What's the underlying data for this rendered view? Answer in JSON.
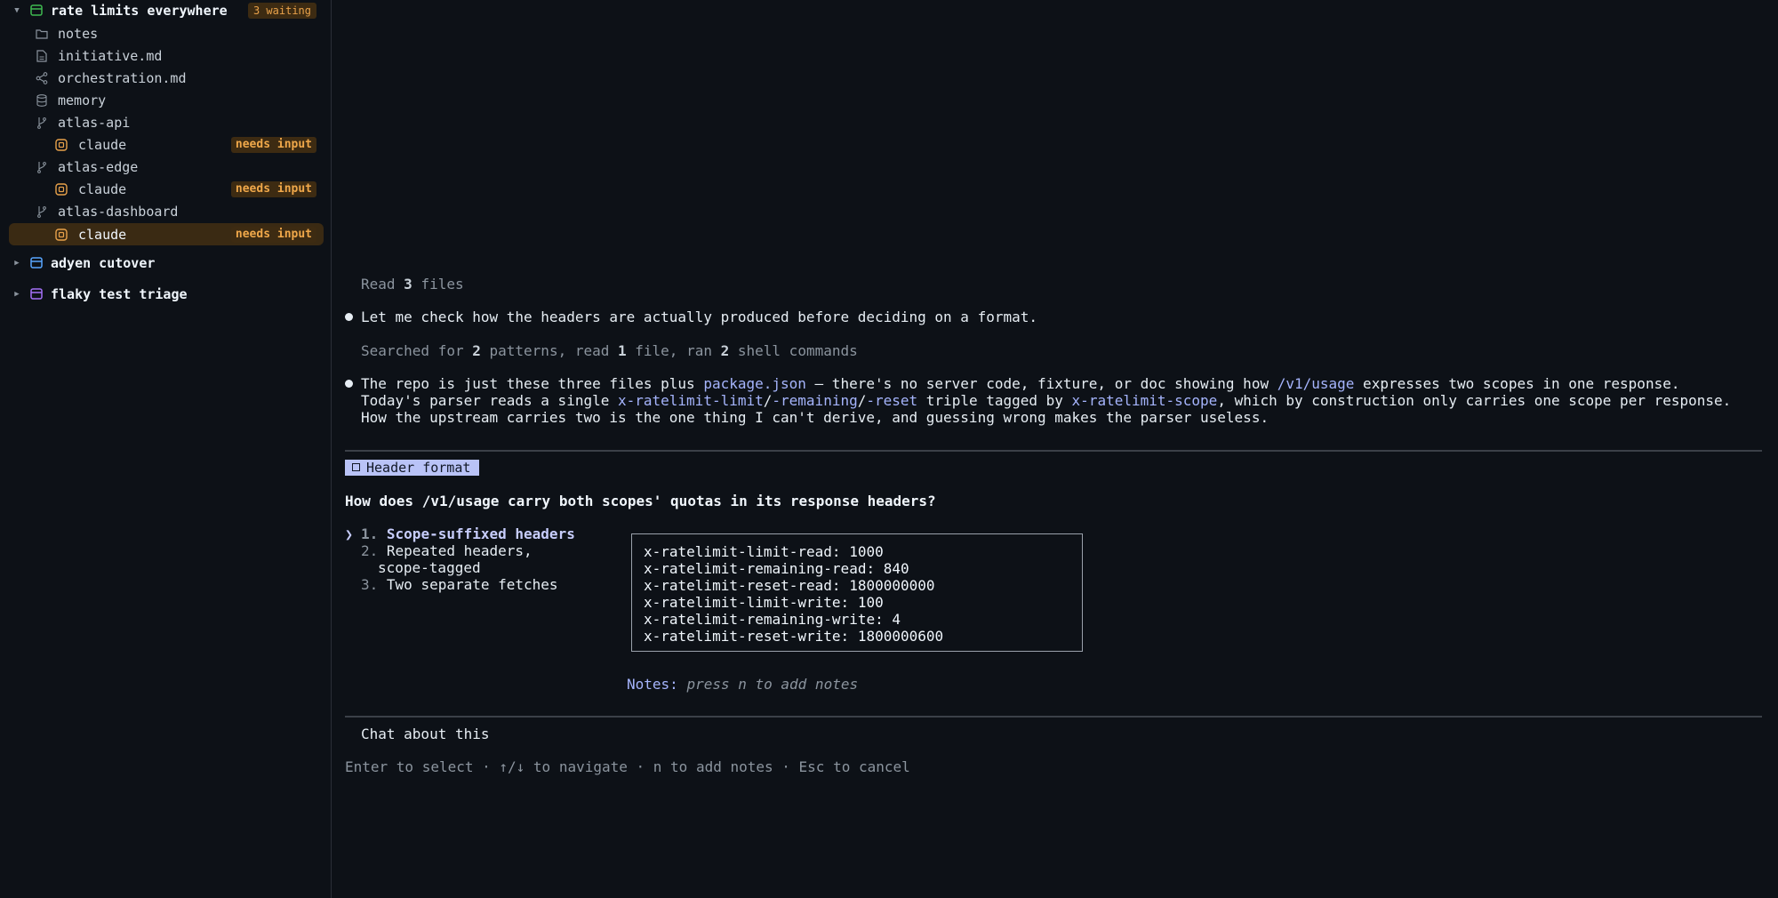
{
  "sidebar": {
    "projects": [
      {
        "name": "rate limits everywhere",
        "status": "3 waiting",
        "icon": "folder-stack-icon",
        "color": "#3fb950"
      },
      {
        "name": "adyen cutover",
        "icon": "folder-stack-icon",
        "color": "#58a6ff"
      },
      {
        "name": "flaky test triage",
        "icon": "folder-stack-icon",
        "color": "#a371f7"
      }
    ],
    "items": [
      {
        "label": "notes",
        "icon": "folder-icon"
      },
      {
        "label": "initiative.md",
        "icon": "file-icon"
      },
      {
        "label": "orchestration.md",
        "icon": "share-icon"
      },
      {
        "label": "memory",
        "icon": "database-icon"
      },
      {
        "label": "atlas-api",
        "icon": "branch-icon"
      },
      {
        "label": "claude",
        "icon": "agent-icon",
        "badge": "needs input"
      },
      {
        "label": "atlas-edge",
        "icon": "branch-icon"
      },
      {
        "label": "claude",
        "icon": "agent-icon",
        "badge": "needs input"
      },
      {
        "label": "atlas-dashboard",
        "icon": "branch-icon"
      },
      {
        "label": "claude",
        "icon": "agent-icon",
        "badge": "needs input"
      }
    ]
  },
  "chat": {
    "read_files": {
      "pre": "Read ",
      "count": "3",
      "post": " files"
    },
    "msg1": "Let me check how the headers are actually produced before deciding on a format.",
    "searched": {
      "p1": "Searched for ",
      "n1": "2",
      "p2": " patterns, read ",
      "n2": "1",
      "p3": " file, ran ",
      "n3": "2",
      "p4": " shell commands"
    },
    "msg2": {
      "t1": "The repo is just these three files plus ",
      "c1": "package.json",
      "t2": " — there's no server code, fixture, or doc showing how ",
      "c2": "/v1/usage",
      "t3": " expresses two scopes in one response. Today's parser reads a single ",
      "c3": "x-ratelimit-limit",
      "t4": "/",
      "c4": "-remaining",
      "t5": "/",
      "c5": "-reset",
      "t6": " triple tagged by ",
      "c6": "x-ratelimit-scope",
      "t7": ", which by construction only carries one scope per response. How the upstream carries two is the one thing I can't derive, and guessing wrong makes the parser useless."
    }
  },
  "question": {
    "tag": "Header format",
    "text": "How does /v1/usage carry both scopes' quotas in its response headers?",
    "pointer": "❯",
    "options": [
      {
        "num": "1.",
        "label": "Scope-suffixed headers"
      },
      {
        "num": "2.",
        "label": "Repeated headers,",
        "label2": "scope-tagged"
      },
      {
        "num": "3.",
        "label": "Two separate fetches"
      }
    ],
    "preview_lines": [
      "x-ratelimit-limit-read: 1000",
      "x-ratelimit-remaining-read: 840",
      "x-ratelimit-reset-read: 1800000000",
      "x-ratelimit-limit-write: 100",
      "x-ratelimit-remaining-write: 4",
      "x-ratelimit-reset-write: 1800000600"
    ],
    "notes_label": "Notes:",
    "notes_placeholder": "press n to add notes",
    "chat_option": "Chat about this",
    "hint": "Enter to select · ↑/↓ to navigate · n to add notes · Esc to cancel"
  },
  "colors": {
    "background": "#0d1117",
    "accent": "#b9c3f7",
    "badge_text": "#f0a84a",
    "badge_bg": "#3d2b12",
    "selected_row": "#3a2a13",
    "code": "#a5b4fc"
  }
}
